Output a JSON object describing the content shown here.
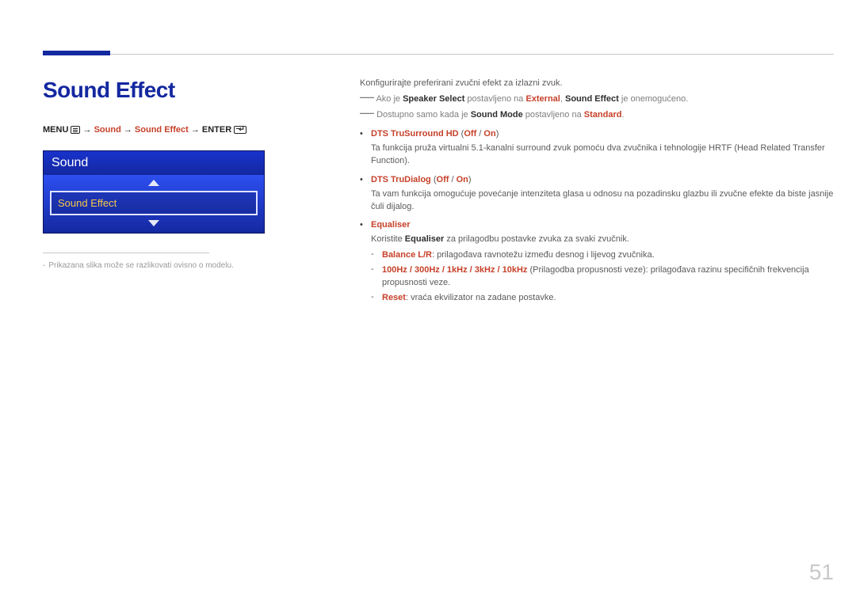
{
  "page_number": "51",
  "page_title": "Sound Effect",
  "breadcrumb": {
    "menu": "MENU",
    "arrow": "→",
    "p1": "Sound",
    "p2": "Sound Effect",
    "enter": "ENTER"
  },
  "osd": {
    "header": "Sound",
    "selected": "Sound Effect"
  },
  "caption_dash": "-",
  "caption": "Prikazana slika može se razlikovati ovisno o modelu.",
  "intro": "Konfigurirajte preferirani zvučni efekt za izlazni zvuk.",
  "note1": {
    "dash": "―",
    "t1": "Ako je ",
    "b1": "Speaker Select",
    "t2": " postavljeno na ",
    "h1": "External",
    "t3": ", ",
    "b2": "Sound Effect",
    "t4": " je onemogućeno."
  },
  "note2": {
    "dash": "―",
    "t1": "Dostupno samo kada je ",
    "b1": "Sound Mode",
    "t2": " postavljeno na ",
    "h1": "Standard",
    "t3": "."
  },
  "features": [
    {
      "name": "DTS TruSurround HD",
      "opt_open": " (",
      "opt1": "Off",
      "sep": " / ",
      "opt2": "On",
      "opt_close": ")",
      "desc": "Ta funkcija pruža virtualni 5.1-kanalni surround zvuk pomoću dva zvučnika i tehnologije HRTF (Head Related Transfer Function)."
    },
    {
      "name": "DTS TruDialog",
      "opt_open": " (",
      "opt1": "Off",
      "sep": " / ",
      "opt2": "On",
      "opt_close": ")",
      "desc": "Ta vam funkcija omogućuje povećanje intenziteta glasa u odnosu na pozadinsku glazbu ili zvučne efekte da biste jasnije čuli dijalog."
    },
    {
      "name": "Equaliser",
      "desc_pre": "Koristite ",
      "desc_bold": "Equaliser",
      "desc_post": " za prilagodbu postavke zvuka za svaki zvučnik.",
      "sub": [
        {
          "h": "Balance L/R",
          "t": ": prilagođava ravnotežu između desnog i lijevog zvučnika."
        },
        {
          "h": "100Hz / 300Hz / 1kHz / 3kHz / 10kHz",
          "t": " (Prilagodba propusnosti veze): prilagođava razinu specifičnih frekvencija propusnosti veze."
        },
        {
          "h": "Reset",
          "t": ": vraća ekvilizator na zadane postavke."
        }
      ]
    }
  ]
}
